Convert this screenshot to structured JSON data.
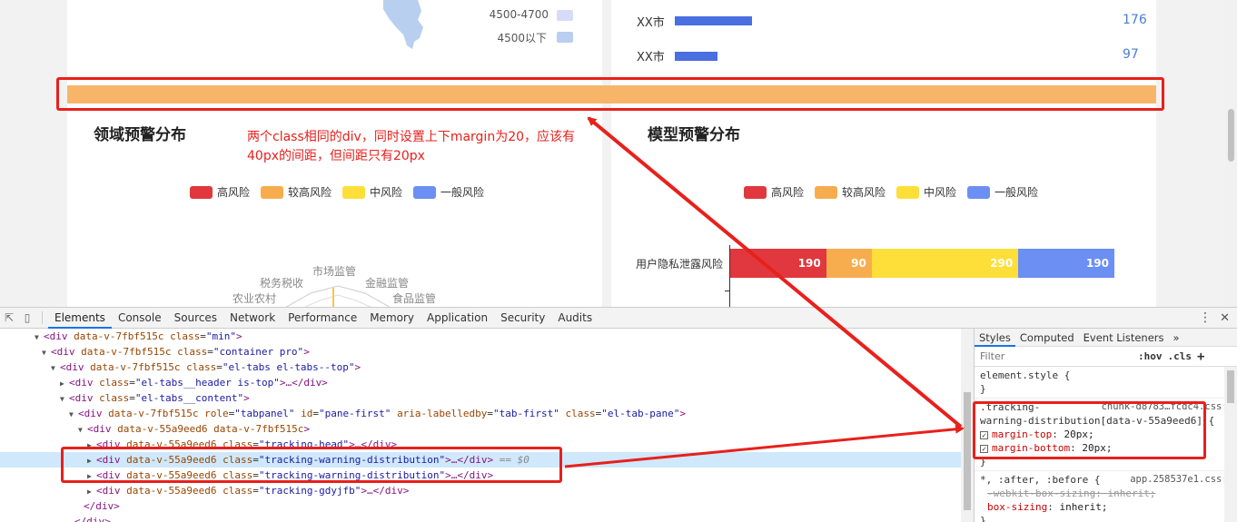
{
  "page": {
    "map_legend": {
      "ranges": [
        "4500-4700",
        "4500以下"
      ],
      "colors": [
        "#d6dcf8",
        "#b8cff0"
      ]
    },
    "city_ranking": [
      {
        "name": "XX市",
        "value": "176",
        "share": 176
      },
      {
        "name": "XX市",
        "value": "97",
        "share": 97
      }
    ],
    "left_section": {
      "title": "领域预警分布",
      "radar_labels": [
        "税务税收",
        "市场监管",
        "金融监管",
        "农业农村",
        "食品监管"
      ]
    },
    "right_section": {
      "title": "模型预警分布",
      "bar_row_label": "用户隐私泄露风险",
      "segments": [
        {
          "value": 190,
          "label": "190",
          "color": "#e0383e"
        },
        {
          "value": 90,
          "label": "90",
          "color": "#f7ad4e"
        },
        {
          "value": 290,
          "label": "290",
          "color": "#fedf3a"
        },
        {
          "value": 190,
          "label": "190",
          "color": "#6b8ff2"
        }
      ]
    },
    "legend": [
      {
        "label": "高风险",
        "color": "#e0383e"
      },
      {
        "label": "较高风险",
        "color": "#f7ad4e"
      },
      {
        "label": "中风险",
        "color": "#fedf3a"
      },
      {
        "label": "一般风险",
        "color": "#6b8ff2"
      }
    ],
    "annotation": "两个class相同的div，同时设置上下margin为20，应该有40px的间距，但间距只有20px",
    "highlight_bar_color": "#f7b56a"
  },
  "devtools": {
    "tabs": [
      "Elements",
      "Console",
      "Sources",
      "Network",
      "Performance",
      "Memory",
      "Application",
      "Security",
      "Audits"
    ],
    "active_tab": "Elements",
    "dom": {
      "l1": {
        "tag": "<div",
        "a1": "data-v-7fbf515c",
        "a2n": "class",
        "a2v": "\"min\"",
        "end": ">"
      },
      "l2": {
        "tag": "<div",
        "a1": "data-v-7fbf515c",
        "a2n": "class",
        "a2v": "\"container pro\"",
        "end": ">"
      },
      "l3": {
        "tag": "<div",
        "a1": "data-v-7fbf515c",
        "a2n": "class",
        "a2v": "\"el-tabs el-tabs--top\"",
        "end": ">"
      },
      "l4": {
        "tag": "<div",
        "a2n": "class",
        "a2v": "\"el-tabs__header is-top\"",
        "end": ">…</div>"
      },
      "l5": {
        "tag": "<div",
        "a2n": "class",
        "a2v": "\"el-tabs__content\"",
        "end": ">"
      },
      "l6": {
        "tag": "<div",
        "a1": "data-v-7fbf515c",
        "a2n": "role",
        "a2v": "\"tabpanel\"",
        "a3n": "id",
        "a3v": "\"pane-first\"",
        "a4n": "aria-labelledby",
        "a4v": "\"tab-first\"",
        "a5n": "class",
        "a5v": "\"el-tab-pane\"",
        "end": ">"
      },
      "l7": {
        "tag": "<div",
        "a1": "data-v-55a9eed6 data-v-7fbf515c",
        "end": ">"
      },
      "l8": {
        "tag": "<div",
        "a1": "data-v-55a9eed6",
        "a2n": "class",
        "a2v": "\"tracking-head\"",
        "end": ">…</div>"
      },
      "l9": {
        "tag": "<div",
        "a1": "data-v-55a9eed6",
        "a2n": "class",
        "a2v": "\"tracking-warning-distribution\"",
        "end": ">…</div>",
        "marker": "== $0"
      },
      "l10": {
        "tag": "<div",
        "a1": "data-v-55a9eed6",
        "a2n": "class",
        "a2v": "\"tracking-warning-distribution\"",
        "end": ">…</div>"
      },
      "l11": {
        "tag": "<div",
        "a1": "data-v-55a9eed6",
        "a2n": "class",
        "a2v": "\"tracking-gdyjfb\"",
        "end": ">…</div>"
      },
      "l12": {
        "tag": "</div>"
      },
      "l13": {
        "tag": "</div>"
      }
    },
    "styles": {
      "tabs": [
        "Styles",
        "Computed",
        "Event Listeners"
      ],
      "more": "»",
      "filter_placeholder": "Filter",
      "hov": ":hov",
      "cls": ".cls",
      "plus": "+",
      "rule0": {
        "selector": "element.style {",
        "close": "}"
      },
      "rule1": {
        "selector1": ".tracking-",
        "selector2": "warning-distribution[data-v-55a9eed6] {",
        "source": "chunk-d8783…fcdc4.css:1",
        "props": [
          {
            "name": "margin-top",
            "value": "20px;"
          },
          {
            "name": "margin-bottom",
            "value": "20px;"
          }
        ],
        "close": "}"
      },
      "rule2": {
        "selector": "*, :after, :before {",
        "source": "app.258537e1.css:1",
        "props": [
          {
            "name": "-webkit-box-sizing",
            "value": "inherit;",
            "struck": true
          },
          {
            "name": "box-sizing",
            "value": "inherit;",
            "struck": false
          }
        ],
        "close": "}"
      }
    }
  }
}
